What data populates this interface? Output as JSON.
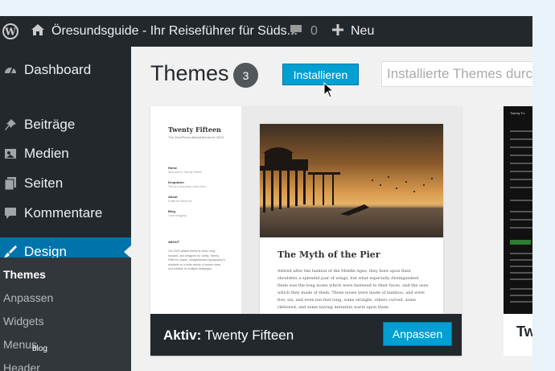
{
  "adminbar": {
    "site_name": "Öresundsguide - Ihr Reiseführer für Süds...",
    "comments_count": "0",
    "new_label": "Neu"
  },
  "sidebar": {
    "items": [
      {
        "label": "Dashboard",
        "icon": "dashboard-icon"
      },
      {
        "label": "Beiträge",
        "icon": "pin-icon"
      },
      {
        "label": "Medien",
        "icon": "media-icon"
      },
      {
        "label": "Seiten",
        "icon": "pages-icon"
      },
      {
        "label": "Kommentare",
        "icon": "comment-icon"
      },
      {
        "label": "Design",
        "icon": "brush-icon"
      }
    ],
    "submenu": [
      "Themes",
      "Anpassen",
      "Widgets",
      "Menus",
      "Header"
    ],
    "overlay_tag": "blog"
  },
  "main": {
    "title": "Themes",
    "count": "3",
    "install_label": "Installieren",
    "search_placeholder": "Installierte Themes durc"
  },
  "theme_card": {
    "preview": {
      "site_title": "Twenty Fifteen",
      "site_desc": "The WordPress default theme for 2015.",
      "nav": [
        {
          "label": "Home",
          "desc": "Welcome to Twenty Fifteen"
        },
        {
          "label": "Dropdown",
          "desc": "This is a dropdown menu item"
        },
        {
          "label": "About",
          "desc": "A little bit about me"
        },
        {
          "label": "Blog",
          "desc": "I love blogging"
        }
      ],
      "about_heading": "ABOUT",
      "about_text": "Our 2015 default theme is clean, blog-focused, and designed for clarity. Twenty Fifteen's simple, straightforward typography is readable on a wide variety of screen sizes, and suitable for multiple languages.",
      "article_title": "The Myth of the Pier",
      "article_text": "Attired after the fashion of the Middle Ages, they bore upon their shoulders a splendid pair of wings; but what especially distinguished them was the long noses which were fastened to their faces, and the uses which they made of them. These noses were made of bamboo, and were five, six, and even ten feet long, some straight, others curved, some ribboned, and some having imitation warts upon them."
    },
    "active_prefix": "Aktiv:",
    "active_name": "Twenty Fifteen",
    "customize_label": "Anpassen"
  },
  "second_card": {
    "name": "Tw",
    "preview_title": "Twenty Fo"
  },
  "colors": {
    "adminbar": "#23282d",
    "accent": "#0073aa",
    "button": "#00a0d2",
    "background": "#f1f1f1"
  }
}
